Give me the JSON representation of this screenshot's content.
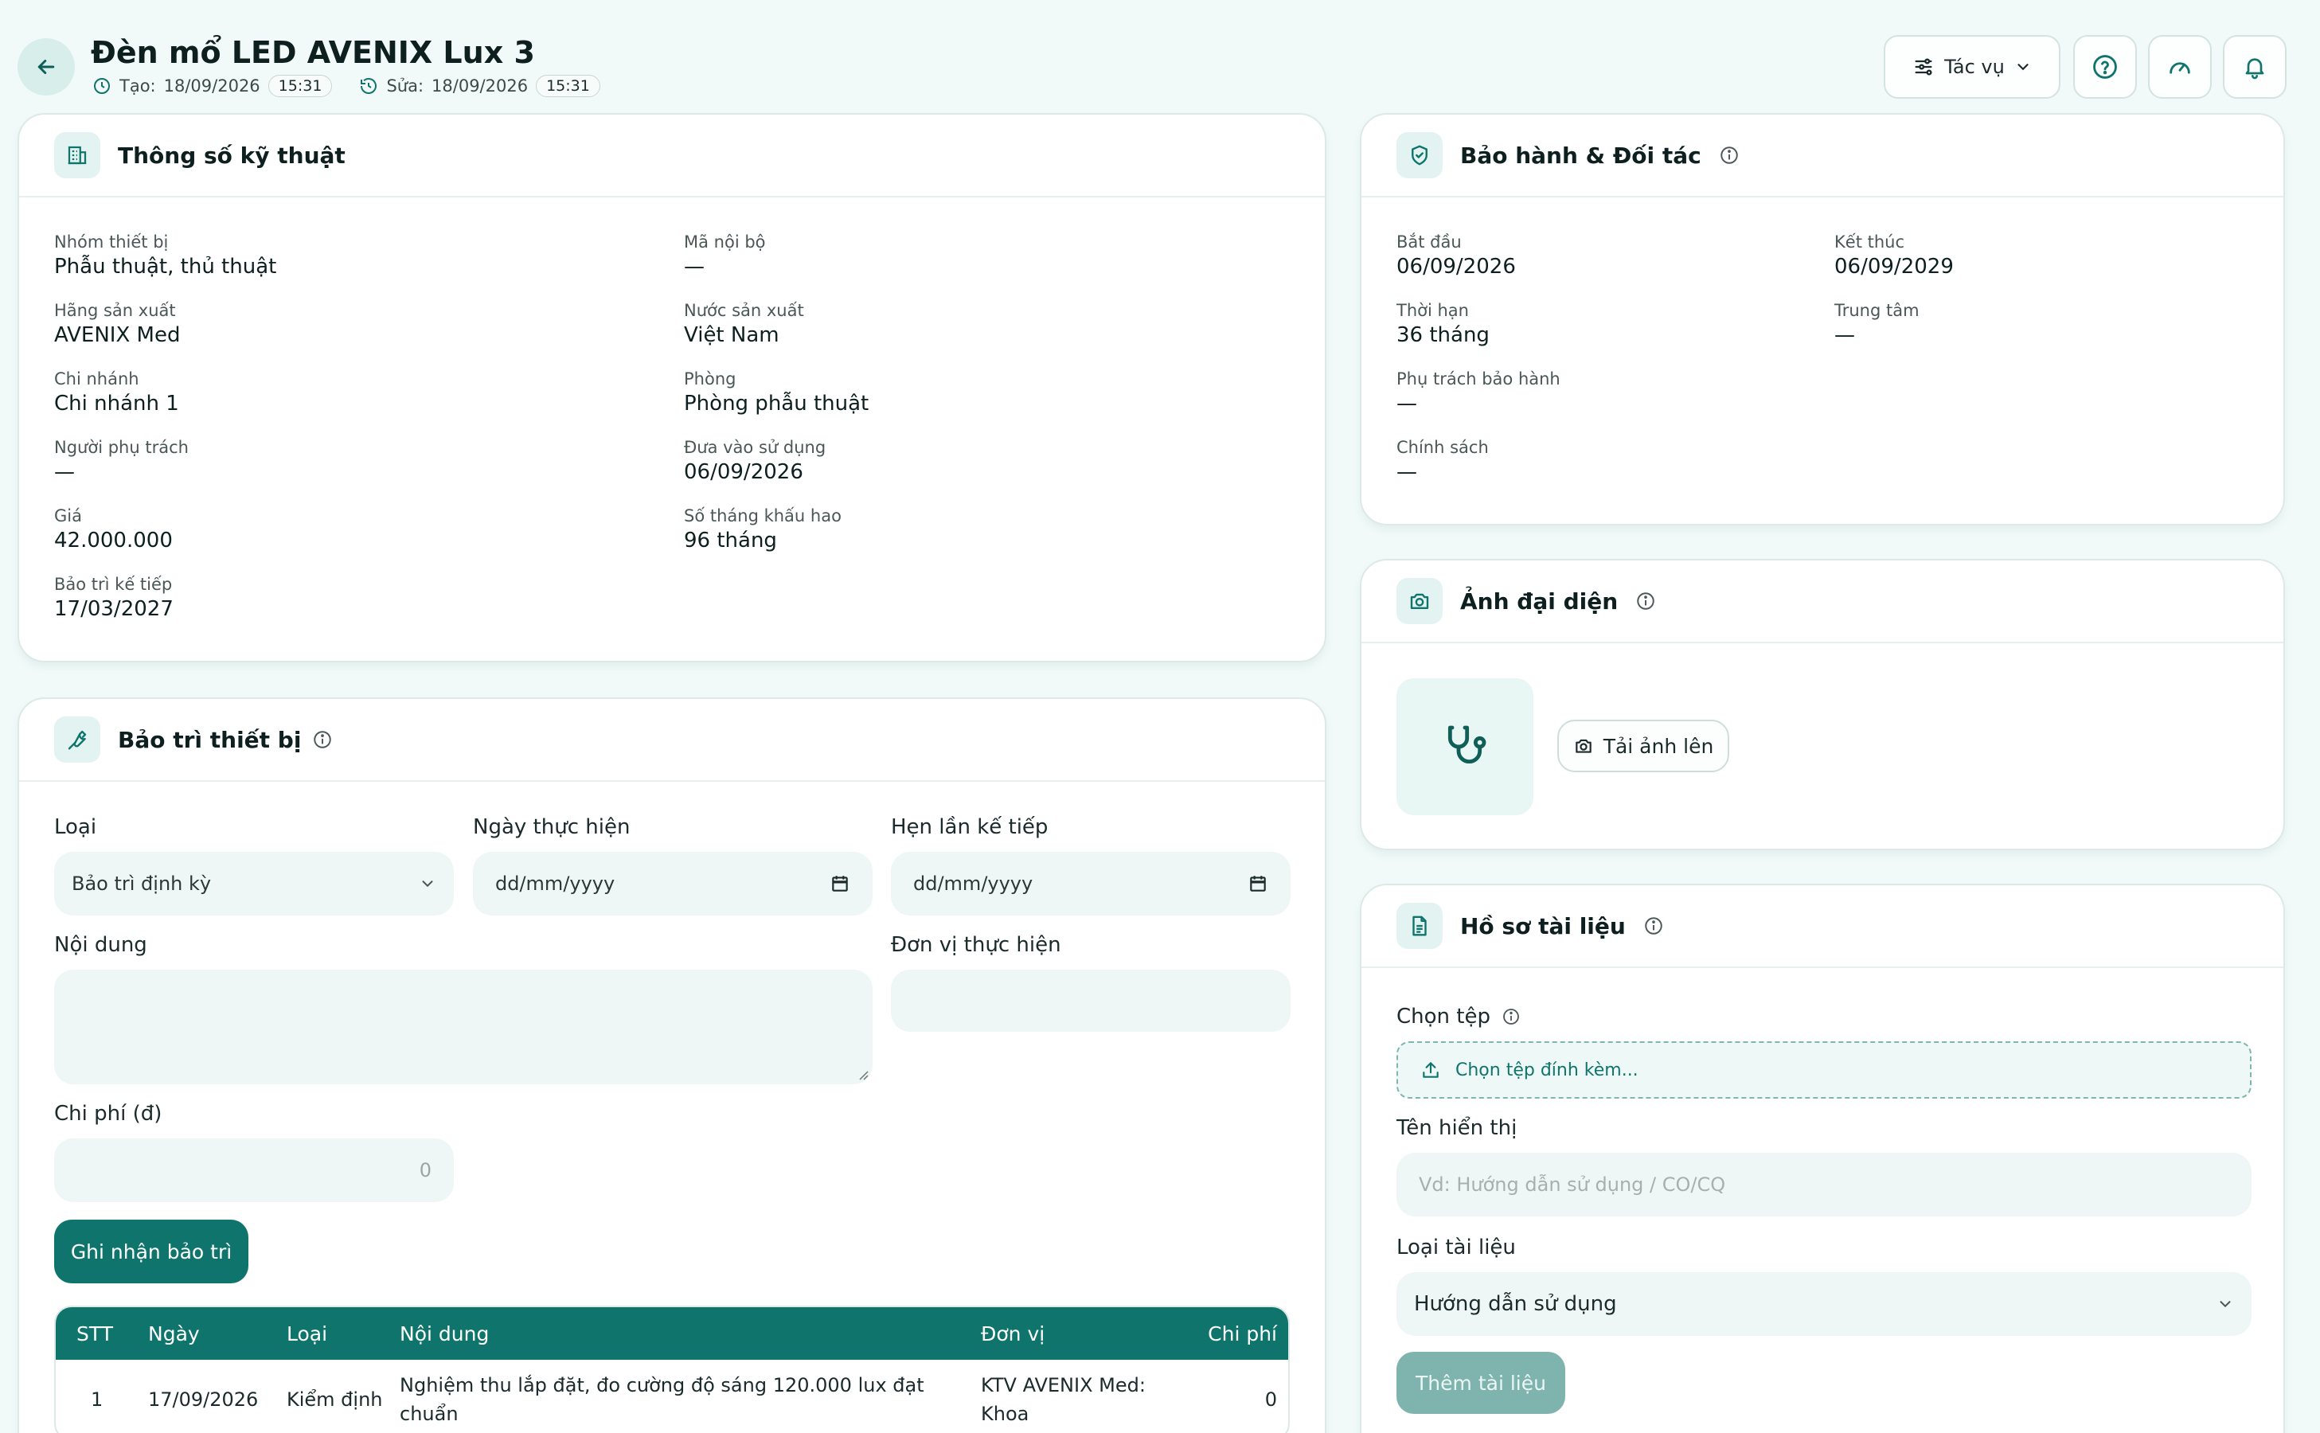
{
  "header": {
    "title": "Đèn mổ LED AVENIX Lux 3",
    "created_label": "Tạo:",
    "created_date": "18/09/2026",
    "created_time": "15:31",
    "updated_label": "Sửa:",
    "updated_date": "18/09/2026",
    "updated_time": "15:31",
    "actions_label": "Tác vụ"
  },
  "specs": {
    "title": "Thông số kỹ thuật",
    "fields": [
      {
        "label": "Nhóm thiết bị",
        "value": "Phẫu thuật, thủ thuật"
      },
      {
        "label": "Mã nội bộ",
        "value": "—"
      },
      {
        "label": "Hãng sản xuất",
        "value": "AVENIX Med"
      },
      {
        "label": "Nước sản xuất",
        "value": "Việt Nam"
      },
      {
        "label": "Chi nhánh",
        "value": "Chi nhánh 1"
      },
      {
        "label": "Phòng",
        "value": "Phòng phẫu thuật"
      },
      {
        "label": "Người phụ trách",
        "value": "—"
      },
      {
        "label": "Đưa vào sử dụng",
        "value": "06/09/2026"
      },
      {
        "label": "Giá",
        "value": "42.000.000"
      },
      {
        "label": "Số tháng khấu hao",
        "value": "96 tháng"
      },
      {
        "label": "Bảo trì kế tiếp",
        "value": "17/03/2027"
      }
    ]
  },
  "warranty": {
    "title": "Bảo hành & Đối tác",
    "fields": [
      {
        "label": "Bắt đầu",
        "value": "06/09/2026"
      },
      {
        "label": "Kết thúc",
        "value": "06/09/2029"
      },
      {
        "label": "Thời hạn",
        "value": "36 tháng"
      },
      {
        "label": "Trung tâm",
        "value": "—"
      },
      {
        "label": "Phụ trách bảo hành",
        "value": "—"
      },
      {
        "label": "Chính sách",
        "value": "—"
      }
    ]
  },
  "avatar": {
    "title": "Ảnh đại diện",
    "upload_label": "Tải ảnh lên"
  },
  "maintenance": {
    "title": "Bảo trì thiết bị",
    "type_label": "Loại",
    "type_value": "Bảo trì định kỳ",
    "date_label": "Ngày thực hiện",
    "date_placeholder": "dd/mm/yyyy",
    "next_label": "Hẹn lần kế tiếp",
    "next_placeholder": "dd/mm/yyyy",
    "content_label": "Nội dung",
    "unit_label": "Đơn vị thực hiện",
    "cost_label": "Chi phí (đ)",
    "cost_placeholder": "0",
    "submit_label": "Ghi nhận bảo trì",
    "table": {
      "headers": [
        "STT",
        "Ngày",
        "Loại",
        "Nội dung",
        "Đơn vị",
        "Chi phí"
      ],
      "rows": [
        [
          "1",
          "17/09/2026",
          "Kiểm định",
          "Nghiệm thu lắp đặt, đo cường độ sáng 120.000 lux đạt chuẩn",
          "KTV AVENIX Med: Khoa",
          "0"
        ]
      ]
    }
  },
  "documents": {
    "title": "Hồ sơ tài liệu",
    "file_label": "Chọn tệp",
    "file_button": "Chọn tệp đính kèm...",
    "name_label": "Tên hiển thị",
    "name_placeholder": "Vd: Hướng dẫn sử dụng / CO/CQ",
    "type_label": "Loại tài liệu",
    "type_value": "Hướng dẫn sử dụng",
    "add_label": "Thêm tài liệu"
  },
  "colors": {
    "accent": "#0f756c",
    "background": "#f1faf9"
  }
}
